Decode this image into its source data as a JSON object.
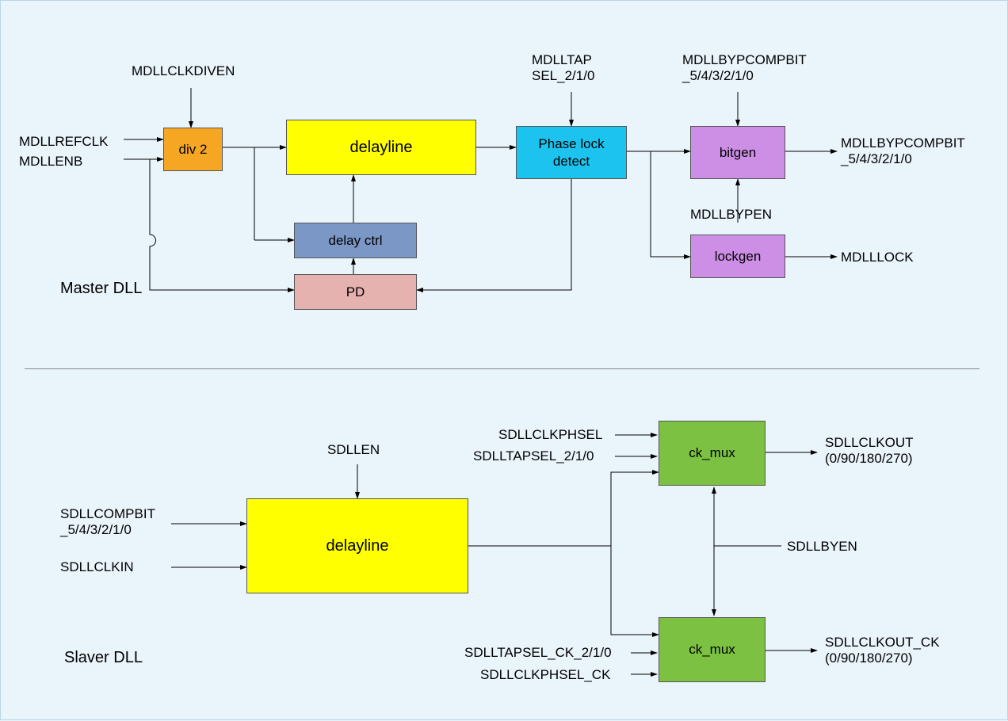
{
  "master": {
    "title": "Master DLL",
    "inputs": {
      "clkdiven": "MDLLCLKDIVEN",
      "refclk": "MDLLREFCLK",
      "enb": "MDLLENB",
      "tapsel": "MDLLTAP\nSEL_2/1/0",
      "bypcompbit_in": "MDLLBYPCOMPBIT\n_5/4/3/2/1/0",
      "bypen": "MDLLBYPEN"
    },
    "outputs": {
      "bypcompbit_out": "MDLLBYPCOMPBIT\n_5/4/3/2/1/0",
      "lock": "MDLLLOCK"
    },
    "blocks": {
      "div2": "div 2",
      "delayline": "delayline",
      "delayctrl": "delay ctrl",
      "pd": "PD",
      "phaselock": "Phase lock\ndetect",
      "bitgen": "bitgen",
      "lockgen": "lockgen"
    }
  },
  "slaver": {
    "title": "Slaver DLL",
    "inputs": {
      "compbit": "SDLLCOMPBIT\n_5/4/3/2/1/0",
      "clkin": "SDLLCLKIN",
      "en": "SDLLEN",
      "clkphsel": "SDLLCLKPHSEL",
      "tapsel": "SDLLTAPSEL_2/1/0",
      "byen": "SDLLBYEN",
      "tapsel_ck": "SDLLTAPSEL_CK_2/1/0",
      "clkphsel_ck": "SDLLCLKPHSEL_CK"
    },
    "outputs": {
      "clkout": "SDLLCLKOUT\n(0/90/180/270)",
      "clkout_ck": "SDLLCLKOUT_CK\n(0/90/180/270)"
    },
    "blocks": {
      "delayline": "delayline",
      "ckmux": "ck_mux"
    }
  }
}
